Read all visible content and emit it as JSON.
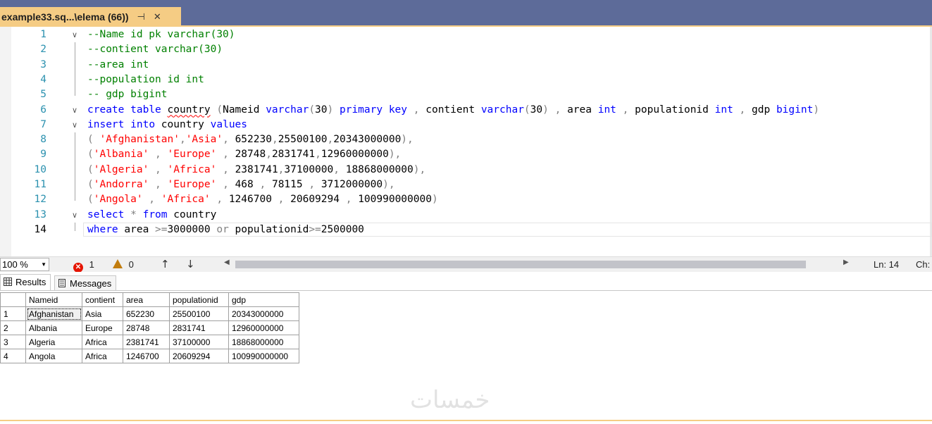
{
  "tab": {
    "title": "example33.sq...\\elema (66))",
    "pin_icon": "pin-icon",
    "close_icon": "close-icon"
  },
  "editor": {
    "lines": [
      {
        "n": "1",
        "fold": "∨",
        "tokens": [
          {
            "t": "--Name id pk varchar(30)",
            "c": "cm"
          }
        ]
      },
      {
        "n": "2",
        "fold": "",
        "tokens": [
          {
            "t": "--contient varchar(30)",
            "c": "cm"
          }
        ]
      },
      {
        "n": "3",
        "fold": "",
        "tokens": [
          {
            "t": "--area int",
            "c": "cm"
          }
        ]
      },
      {
        "n": "4",
        "fold": "",
        "tokens": [
          {
            "t": "--population id int",
            "c": "cm"
          }
        ]
      },
      {
        "n": "5",
        "fold": "",
        "tokens": [
          {
            "t": "-- gdp bigint",
            "c": "cm"
          }
        ]
      },
      {
        "n": "6",
        "fold": "∨",
        "tokens": [
          {
            "t": "create",
            "c": "kw"
          },
          {
            "t": " "
          },
          {
            "t": "table",
            "c": "kw"
          },
          {
            "t": " "
          },
          {
            "t": "country",
            "c": "squig"
          },
          {
            "t": " "
          },
          {
            "t": "(",
            "c": "gr"
          },
          {
            "t": "Nameid "
          },
          {
            "t": "varchar",
            "c": "kw"
          },
          {
            "t": "(",
            "c": "gr"
          },
          {
            "t": "30"
          },
          {
            "t": ")",
            "c": "gr"
          },
          {
            "t": " "
          },
          {
            "t": "primary",
            "c": "kw"
          },
          {
            "t": " "
          },
          {
            "t": "key",
            "c": "kw"
          },
          {
            "t": " , ",
            "c": "gr"
          },
          {
            "t": "contient "
          },
          {
            "t": "varchar",
            "c": "kw"
          },
          {
            "t": "(",
            "c": "gr"
          },
          {
            "t": "30"
          },
          {
            "t": ")",
            "c": "gr"
          },
          {
            "t": " , ",
            "c": "gr"
          },
          {
            "t": "area "
          },
          {
            "t": "int",
            "c": "kw"
          },
          {
            "t": " , ",
            "c": "gr"
          },
          {
            "t": "populationid "
          },
          {
            "t": "int",
            "c": "kw"
          },
          {
            "t": " , ",
            "c": "gr"
          },
          {
            "t": "gdp "
          },
          {
            "t": "bigint",
            "c": "kw"
          },
          {
            "t": ")",
            "c": "gr"
          }
        ]
      },
      {
        "n": "7",
        "fold": "∨",
        "tokens": [
          {
            "t": "insert",
            "c": "kw"
          },
          {
            "t": " "
          },
          {
            "t": "into",
            "c": "kw"
          },
          {
            "t": " country "
          },
          {
            "t": "values",
            "c": "kw"
          }
        ]
      },
      {
        "n": "8",
        "fold": "",
        "tokens": [
          {
            "t": "( ",
            "c": "gr"
          },
          {
            "t": "'Afghanistan'",
            "c": "str"
          },
          {
            "t": ",",
            "c": "gr"
          },
          {
            "t": "'Asia'",
            "c": "str"
          },
          {
            "t": ", ",
            "c": "gr"
          },
          {
            "t": "652230"
          },
          {
            "t": ",",
            "c": "gr"
          },
          {
            "t": "25500100"
          },
          {
            "t": ",",
            "c": "gr"
          },
          {
            "t": "20343000000"
          },
          {
            "t": "),",
            "c": "gr"
          }
        ]
      },
      {
        "n": "9",
        "fold": "",
        "tokens": [
          {
            "t": "(",
            "c": "gr"
          },
          {
            "t": "'Albania'",
            "c": "str"
          },
          {
            "t": " , ",
            "c": "gr"
          },
          {
            "t": "'Europe'",
            "c": "str"
          },
          {
            "t": " , ",
            "c": "gr"
          },
          {
            "t": "28748"
          },
          {
            "t": ",",
            "c": "gr"
          },
          {
            "t": "2831741"
          },
          {
            "t": ",",
            "c": "gr"
          },
          {
            "t": "12960000000"
          },
          {
            "t": "),",
            "c": "gr"
          }
        ]
      },
      {
        "n": "10",
        "fold": "",
        "tokens": [
          {
            "t": "(",
            "c": "gr"
          },
          {
            "t": "'Algeria'",
            "c": "str"
          },
          {
            "t": " , ",
            "c": "gr"
          },
          {
            "t": "'Africa'",
            "c": "str"
          },
          {
            "t": " , ",
            "c": "gr"
          },
          {
            "t": "2381741"
          },
          {
            "t": ",",
            "c": "gr"
          },
          {
            "t": "37100000"
          },
          {
            "t": ", ",
            "c": "gr"
          },
          {
            "t": "18868000000"
          },
          {
            "t": "),",
            "c": "gr"
          }
        ]
      },
      {
        "n": "11",
        "fold": "",
        "tokens": [
          {
            "t": "(",
            "c": "gr"
          },
          {
            "t": "'Andorra'",
            "c": "str"
          },
          {
            "t": " , ",
            "c": "gr"
          },
          {
            "t": "'Europe'",
            "c": "str"
          },
          {
            "t": " , ",
            "c": "gr"
          },
          {
            "t": "468"
          },
          {
            "t": " , ",
            "c": "gr"
          },
          {
            "t": "78115"
          },
          {
            "t": " , ",
            "c": "gr"
          },
          {
            "t": "3712000000"
          },
          {
            "t": "),",
            "c": "gr"
          }
        ]
      },
      {
        "n": "12",
        "fold": "",
        "tokens": [
          {
            "t": "(",
            "c": "gr"
          },
          {
            "t": "'Angola'",
            "c": "str"
          },
          {
            "t": " , ",
            "c": "gr"
          },
          {
            "t": "'Africa'",
            "c": "str"
          },
          {
            "t": " , ",
            "c": "gr"
          },
          {
            "t": "1246700"
          },
          {
            "t": " , ",
            "c": "gr"
          },
          {
            "t": "20609294"
          },
          {
            "t": " , ",
            "c": "gr"
          },
          {
            "t": "100990000000"
          },
          {
            "t": ")",
            "c": "gr"
          }
        ]
      },
      {
        "n": "13",
        "fold": "∨",
        "tokens": [
          {
            "t": "select",
            "c": "kw"
          },
          {
            "t": " "
          },
          {
            "t": "*",
            "c": "gr"
          },
          {
            "t": " "
          },
          {
            "t": "from",
            "c": "kw"
          },
          {
            "t": " country"
          }
        ]
      },
      {
        "n": "14",
        "fold": "",
        "tokens": [
          {
            "t": "where",
            "c": "kw"
          },
          {
            "t": " area "
          },
          {
            "t": ">=",
            "c": "gr"
          },
          {
            "t": "3000000 "
          },
          {
            "t": "or",
            "c": "gr"
          },
          {
            "t": " populationid"
          },
          {
            "t": ">=",
            "c": "gr"
          },
          {
            "t": "2500000"
          }
        ]
      }
    ]
  },
  "status": {
    "zoom": "100 %",
    "errors": "1",
    "warnings": "0",
    "ln": "Ln: 14",
    "ch": "Ch:"
  },
  "results": {
    "tabs": [
      {
        "label": "Results",
        "icon": "grid-icon"
      },
      {
        "label": "Messages",
        "icon": "messages-icon"
      }
    ],
    "columns": [
      "",
      "Nameid",
      "contient",
      "area",
      "populationid",
      "gdp"
    ],
    "rows": [
      [
        "1",
        "Afghanistan",
        "Asia",
        "652230",
        "25500100",
        "20343000000"
      ],
      [
        "2",
        "Albania",
        "Europe",
        "28748",
        "2831741",
        "12960000000"
      ],
      [
        "3",
        "Algeria",
        "Africa",
        "2381741",
        "37100000",
        "18868000000"
      ],
      [
        "4",
        "Angola",
        "Africa",
        "1246700",
        "20609294",
        "100990000000"
      ]
    ]
  },
  "watermark": "خمسات",
  "colors": {
    "titlebar": "#5d6b99",
    "active_tab": "#f5cc84",
    "keyword": "#0000ff",
    "string": "#ff0000",
    "comment": "#008000",
    "line_number": "#2b91af"
  }
}
